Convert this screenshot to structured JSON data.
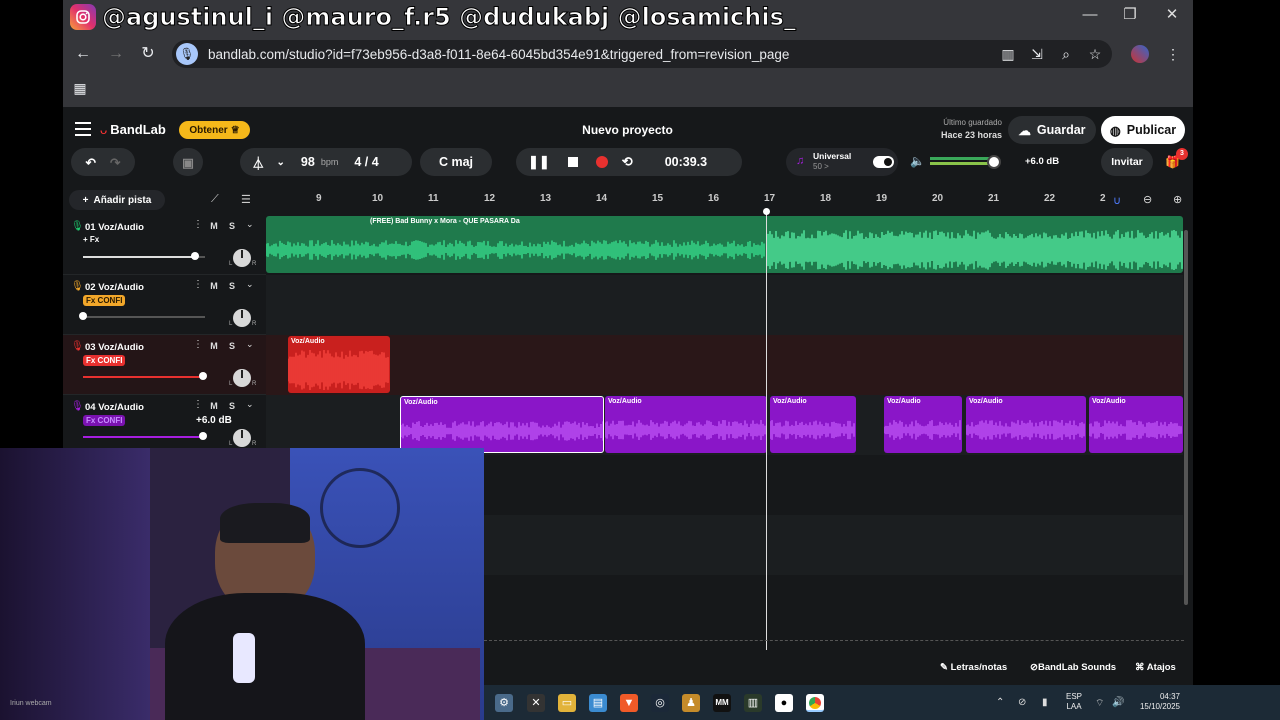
{
  "overlay": {
    "handles": "@agustinul_i  @mauro_f.r5  @dudukabj @losamichis_"
  },
  "browser": {
    "url": "bandlab.com/studio?id=f73eb956-d3a8-f011-8e64-6045bd354e91&triggered_from=revision_page",
    "tab_ghost": "Nuevo proyecto"
  },
  "app": {
    "brand": "BandLab",
    "obtener": "Obtener",
    "project_title": "Nuevo proyecto",
    "last_saved_label": "Último guardado",
    "last_saved_time": "Hace 23 horas",
    "save": "Guardar",
    "publish": "Publicar"
  },
  "toolbar": {
    "bpm_value": "98",
    "bpm_unit": "bpm",
    "time_sig": "4 / 4",
    "key": "C maj",
    "time": "00:39.3",
    "preset_name": "Universal",
    "preset_sub": "50 >",
    "volume_db": "+6.0 dB",
    "invite": "Invitar",
    "gift_badge": "3"
  },
  "tracks_header": {
    "add_track": "Añadir pista"
  },
  "ruler": [
    "9",
    "10",
    "11",
    "12",
    "13",
    "14",
    "15",
    "16",
    "17",
    "18",
    "19",
    "20",
    "21",
    "22",
    "2"
  ],
  "tracks": [
    {
      "num": "01",
      "name": "Voz/Audio",
      "fx": "+ Fx",
      "fx_style": "plain",
      "color": "#1ecb6e",
      "volume": 0.92
    },
    {
      "num": "02",
      "name": "Voz/Audio",
      "fx": "Fx CONFI",
      "fx_style": "orange",
      "color": "#f2a72a",
      "volume": 0.0
    },
    {
      "num": "03",
      "name": "Voz/Audio",
      "fx": "Fx CONFI",
      "fx_style": "red",
      "color": "#e8312f",
      "volume": 0.98
    },
    {
      "num": "04",
      "name": "Voz/Audio",
      "fx": "Fx CONFI",
      "fx_style": "purple",
      "color": "#a61ee0",
      "volume": 0.98
    }
  ],
  "volume_tooltip": "+6.0 dB",
  "clips": {
    "lane1_label": "(FREE) Bad Bunny x Mora - QUE PASARA Da",
    "lane3_label": "Voz/Audio",
    "lane4_labels": [
      "Voz/Audio",
      "Voz/Audio",
      "Voz/Audio",
      "Voz/Audio",
      "Voz/Audio",
      "Voz/Audio"
    ]
  },
  "footer": {
    "lyrics": "Letras/notas",
    "sounds": "BandLab Sounds",
    "shortcuts": "Atajos"
  },
  "taskbar": {
    "lang1": "ESP",
    "lang2": "LAA",
    "time": "04:37",
    "date": "15/10/2025"
  },
  "colors": {
    "green": "#1ecb6e",
    "red": "#e8312f",
    "purple": "#a61ee0",
    "orange": "#f2a72a"
  }
}
